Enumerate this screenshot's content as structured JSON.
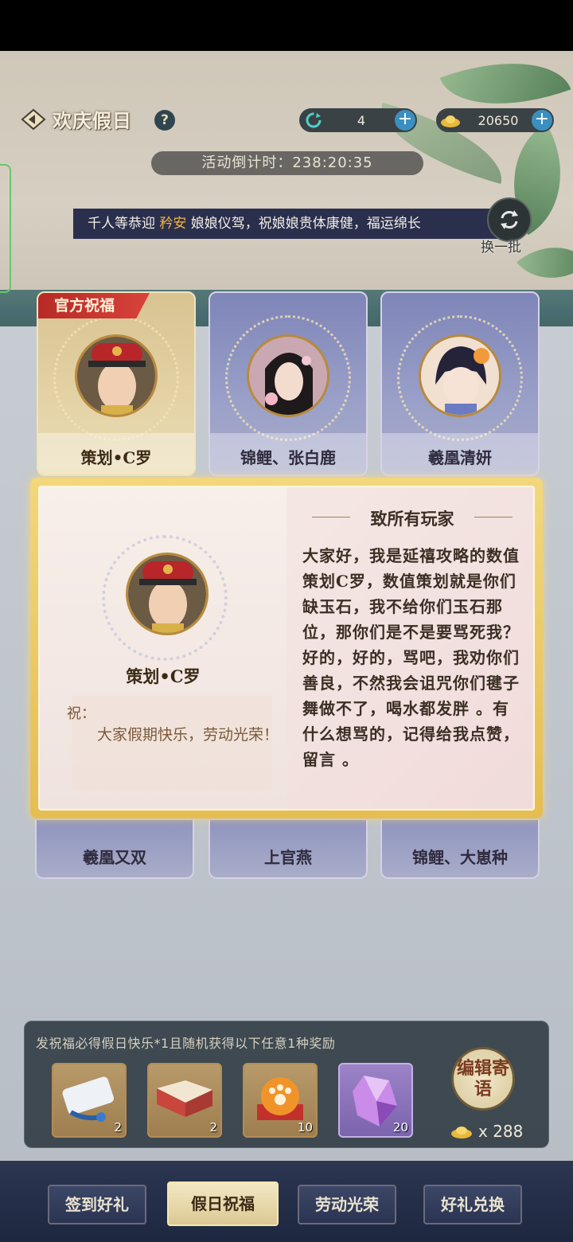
{
  "header": {
    "title": "欢庆假日",
    "help_symbol": "?",
    "resource_refresh": {
      "value": "4",
      "plus": "+"
    },
    "resource_gold": {
      "value": "20650",
      "plus": "+"
    },
    "countdown": "活动倒计时：238:20:35"
  },
  "marquee": {
    "prefix": "千人等恭迎 ",
    "highlight": "矜安",
    "suffix": " 娘娘仪驾，祝娘娘贵体康健，福运绵长",
    "refresh_label": "换一批"
  },
  "cards_top": [
    {
      "name": "策划•C罗",
      "tag": "官方祝福"
    },
    {
      "name": "锦鲤、张白鹿"
    },
    {
      "name": "羲凰清妍"
    }
  ],
  "cards_bottom": [
    {
      "name": "羲凰又双"
    },
    {
      "name": "上官燕"
    },
    {
      "name": "锦鲤、大崽种"
    }
  ],
  "popup": {
    "sender": "策划•C罗",
    "wish_label": "祝：",
    "wish_text": "大家假期快乐，劳动光荣！",
    "letter_title": "致所有玩家",
    "letter_body": "大家好，我是延禧攻略的数值策划C罗，数值策划就是你们缺玉石，我不给你们玉石那位，那你们是不是要骂死我？好的，好的，骂吧，我劝你们善良，不然我会诅咒你们毽子舞做不了，喝水都发胖 。有什么想骂的，记得给我点赞，留言 。"
  },
  "rewards": {
    "description": "发祝福必得假日快乐*1且随机获得以下任意1种奖励",
    "items": [
      {
        "icon": "scroll-icon",
        "count": "2"
      },
      {
        "icon": "book-icon",
        "count": "2"
      },
      {
        "icon": "pawprint-ball-icon",
        "count": "10"
      },
      {
        "icon": "purple-crystal-icon",
        "count": "20"
      }
    ],
    "edit_button": "编辑寄语",
    "cost": "x 288"
  },
  "nav": {
    "tabs": [
      "签到好礼",
      "假日祝福",
      "劳动光荣",
      "好礼兑换"
    ],
    "active_index": 1
  },
  "colors": {
    "accent_gold": "#f4b544",
    "tag_red": "#c9322d",
    "nav_bg": "#2c3651"
  }
}
